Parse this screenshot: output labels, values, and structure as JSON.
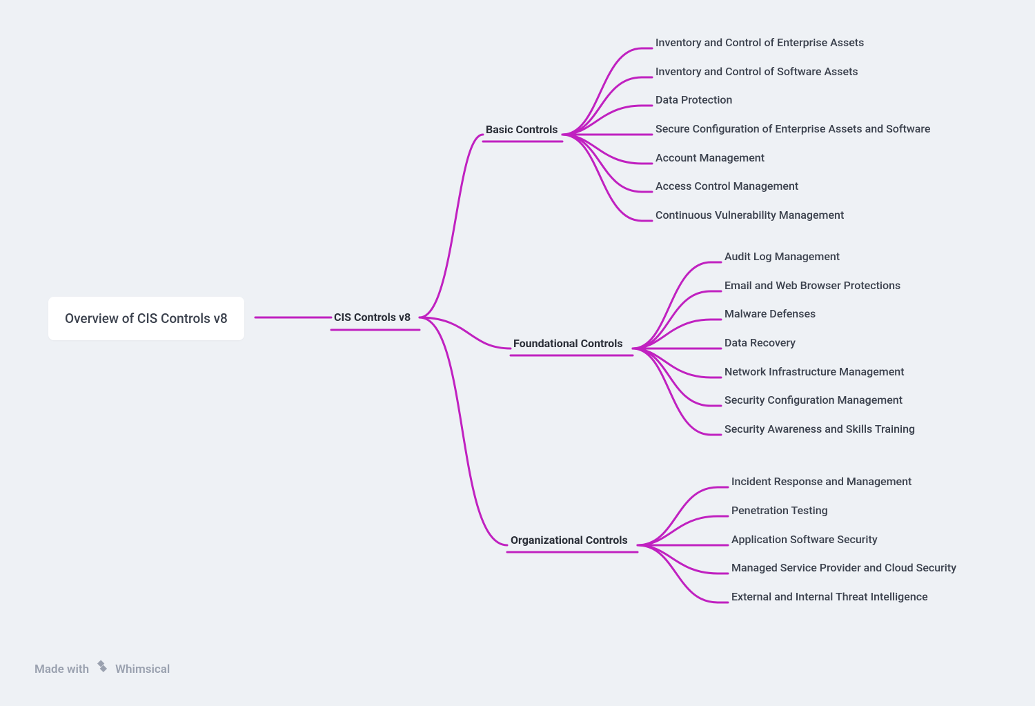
{
  "diagram": {
    "color_branch": "#c021c0",
    "root": {
      "label": "Overview of CIS Controls v8"
    },
    "level1": {
      "label": "CIS Controls v8"
    },
    "branches": [
      {
        "label": "Basic Controls",
        "children": [
          "Inventory and Control of Enterprise Assets",
          "Inventory and Control of Software Assets",
          "Data Protection",
          "Secure Configuration of Enterprise Assets and Software",
          "Account Management",
          "Access Control Management",
          "Continuous Vulnerability Management"
        ]
      },
      {
        "label": "Foundational Controls",
        "children": [
          "Audit Log Management",
          "Email and Web Browser Protections",
          "Malware Defenses",
          "Data Recovery",
          "Network Infrastructure Management",
          "Security Configuration Management",
          "Security Awareness and Skills Training"
        ]
      },
      {
        "label": "Organizational Controls",
        "children": [
          "Incident Response and Management",
          "Penetration Testing",
          "Application Software Security",
          "Managed Service Provider and Cloud Security",
          "External and Internal Threat Intelligence"
        ]
      }
    ]
  },
  "footer": {
    "made_with": "Made with",
    "brand": "Whimsical"
  }
}
